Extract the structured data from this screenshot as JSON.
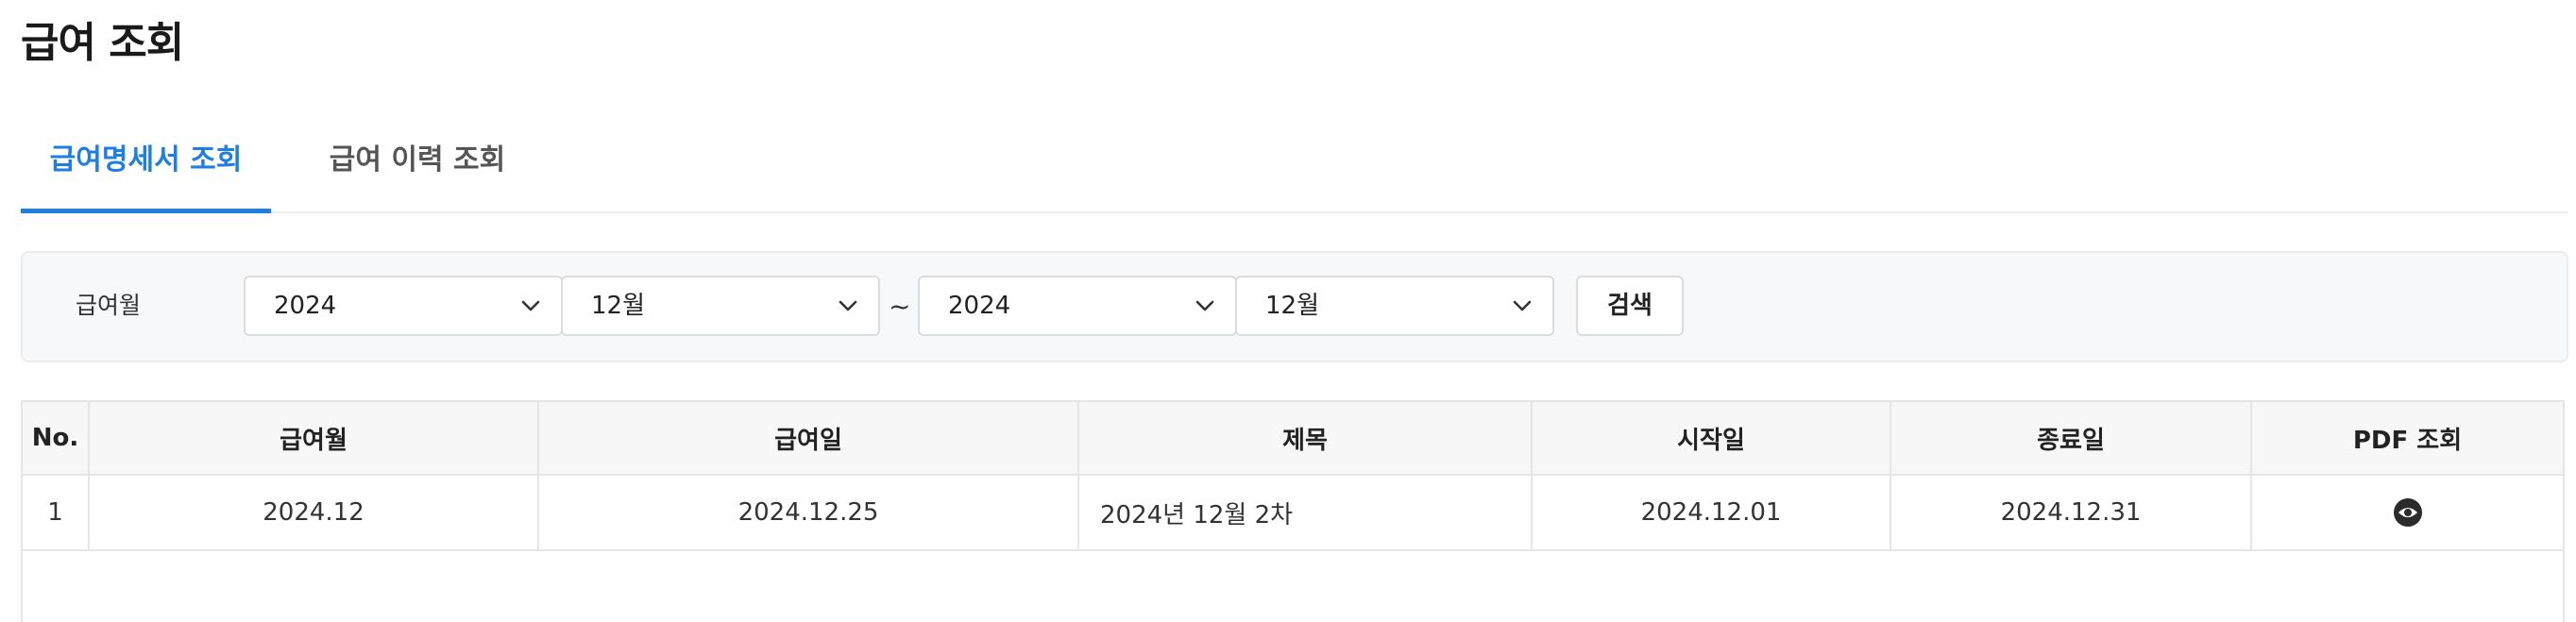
{
  "page": {
    "title": "급여 조회"
  },
  "tabs": [
    {
      "label": "급여명세서 조회",
      "active": true
    },
    {
      "label": "급여 이력 조회",
      "active": false
    }
  ],
  "search": {
    "label": "급여월",
    "from_year": "2024",
    "from_month": "12월",
    "separator": "~",
    "to_year": "2024",
    "to_month": "12월",
    "button_label": "검색"
  },
  "table": {
    "headers": [
      "No.",
      "급여월",
      "급여일",
      "제목",
      "시작일",
      "종료일",
      "PDF 조회"
    ],
    "rows": [
      {
        "no": "1",
        "pay_month": "2024.12",
        "pay_date": "2024.12.25",
        "title": "2024년 12월 2차",
        "start_date": "2024.12.01",
        "end_date": "2024.12.31",
        "pdf_icon": "eye-icon"
      }
    ]
  },
  "colors": {
    "accent": "#1f7fe0",
    "border": "#e6e6e6",
    "panel_bg": "#f7f8fa"
  }
}
